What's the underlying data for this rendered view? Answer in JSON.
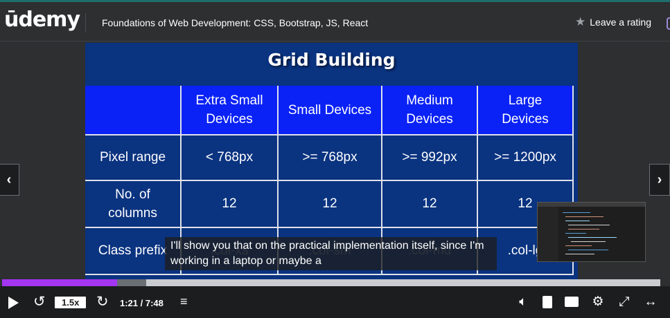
{
  "header": {
    "logo_text": "ūdemy",
    "course_title": "Foundations of Web Development: CSS, Bootstrap, JS, React",
    "rating_label": "Leave a rating",
    "rating_icon": "star-icon"
  },
  "slide": {
    "title": "Grid Building",
    "table": {
      "headers": [
        "",
        "Extra Small\nDevices",
        "Small Devices",
        "Medium\nDevices",
        "Large\nDevices"
      ],
      "rows": [
        {
          "label": "Pixel range",
          "cells": [
            "< 768px",
            ">= 768px",
            ">= 992px",
            ">= 1200px"
          ]
        },
        {
          "label": "No. of columns",
          "cells": [
            "12",
            "12",
            "12",
            "12"
          ]
        },
        {
          "label": "Class prefix",
          "cells": [
            ".col-xs",
            ".col-sm",
            ".col-md",
            ".col-lg"
          ]
        }
      ]
    }
  },
  "caption": {
    "text": "I'll show you that on the practical implementation itself, since I'm working in a laptop or maybe a"
  },
  "navigation": {
    "prev_icon": "chevron-left-icon",
    "next_icon": "chevron-right-icon"
  },
  "player": {
    "progress": {
      "played_fraction": 0.175,
      "buffered_fraction": 0.219
    },
    "speed_label": "1.5x",
    "time_label": "1:21 / 7:48",
    "watermark": "Udemy",
    "icons": [
      "play-icon",
      "rewind-5s-icon",
      "forward-5s-icon",
      "notes-icon",
      "volume-icon",
      "transcript-icon",
      "captions-icon",
      "settings-icon",
      "fullscreen-icon",
      "expand-icon"
    ]
  },
  "colors": {
    "accent": "#a435f0",
    "slide_bg": "#0a3380",
    "header_row_bg": "#0a22f5"
  }
}
